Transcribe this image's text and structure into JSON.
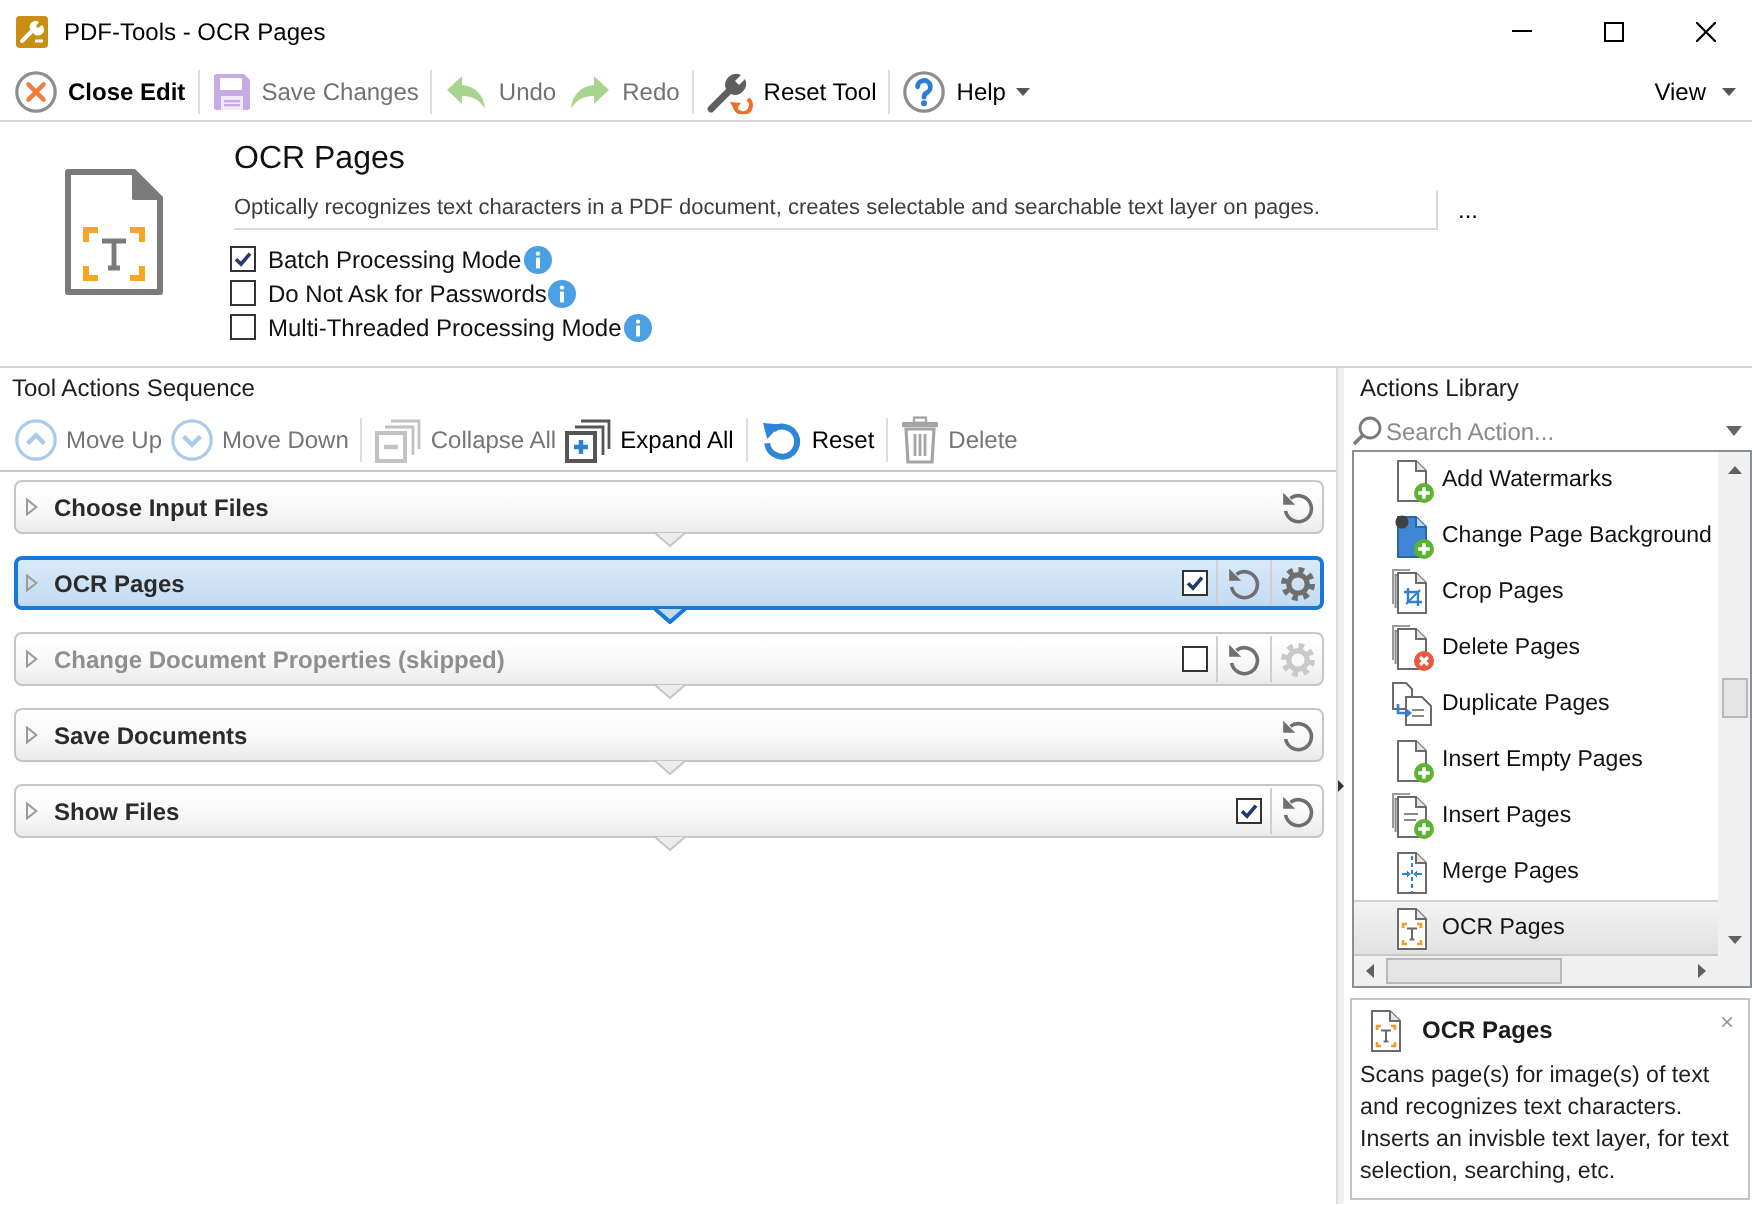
{
  "window": {
    "title": "PDF-Tools - OCR Pages"
  },
  "toolbar": {
    "items": [
      {
        "label": "Close Edit",
        "disabled": false,
        "dropdown": false
      },
      {
        "label": "Save Changes",
        "disabled": true,
        "dropdown": false
      },
      {
        "label": "Undo",
        "disabled": true,
        "dropdown": false
      },
      {
        "label": "Redo",
        "disabled": true,
        "dropdown": false
      },
      {
        "label": "Reset Tool",
        "disabled": false,
        "dropdown": false
      },
      {
        "label": "Help",
        "disabled": false,
        "dropdown": true
      }
    ],
    "view_menu": {
      "label": "View",
      "dropdown": true
    }
  },
  "tool_header": {
    "title": "OCR Pages",
    "description": "Optically recognizes text characters in a PDF document, creates selectable and searchable text layer on pages.",
    "more_button": "...",
    "options": [
      {
        "label": "Batch Processing Mode",
        "checked": true
      },
      {
        "label": "Do Not Ask for Passwords",
        "checked": false
      },
      {
        "label": "Multi-Threaded Processing Mode",
        "checked": false
      }
    ]
  },
  "sequence": {
    "title": "Tool Actions Sequence",
    "toolbar": [
      {
        "label": "Move Up",
        "disabled": true
      },
      {
        "label": "Move Down",
        "disabled": true
      },
      {
        "label": "Collapse All",
        "disabled": true
      },
      {
        "label": "Expand All",
        "disabled": false
      },
      {
        "label": "Reset",
        "disabled": false
      },
      {
        "label": "Delete",
        "disabled": true
      }
    ],
    "actions": [
      {
        "kind": "fixed",
        "label": "Choose Input Files",
        "selected": false,
        "skipped": false
      },
      {
        "kind": "action",
        "label": "OCR Pages",
        "selected": true,
        "skipped": false,
        "checked": true
      },
      {
        "kind": "action",
        "label": "Change Document Properties (skipped)",
        "selected": false,
        "skipped": true,
        "checked": false
      },
      {
        "kind": "fixed",
        "label": "Save Documents",
        "selected": false,
        "skipped": false
      },
      {
        "kind": "option",
        "label": "Show Files",
        "selected": false,
        "skipped": false,
        "checked": true
      }
    ]
  },
  "library": {
    "title": "Actions Library",
    "search": {
      "placeholder": "Search Action..."
    },
    "items": [
      {
        "label": "Add Watermarks",
        "selected": false
      },
      {
        "label": "Change Page Background",
        "selected": false
      },
      {
        "label": "Crop Pages",
        "selected": false
      },
      {
        "label": "Delete Pages",
        "selected": false
      },
      {
        "label": "Duplicate Pages",
        "selected": false
      },
      {
        "label": "Insert Empty Pages",
        "selected": false
      },
      {
        "label": "Insert Pages",
        "selected": false
      },
      {
        "label": "Merge Pages",
        "selected": false
      },
      {
        "label": "OCR Pages",
        "selected": true
      }
    ]
  },
  "info_panel": {
    "title": "OCR Pages",
    "close": "×",
    "description": "Scans page(s) for image(s) of text and recognizes text characters. Inserts an invisble text layer, for text selection, searching, etc."
  }
}
